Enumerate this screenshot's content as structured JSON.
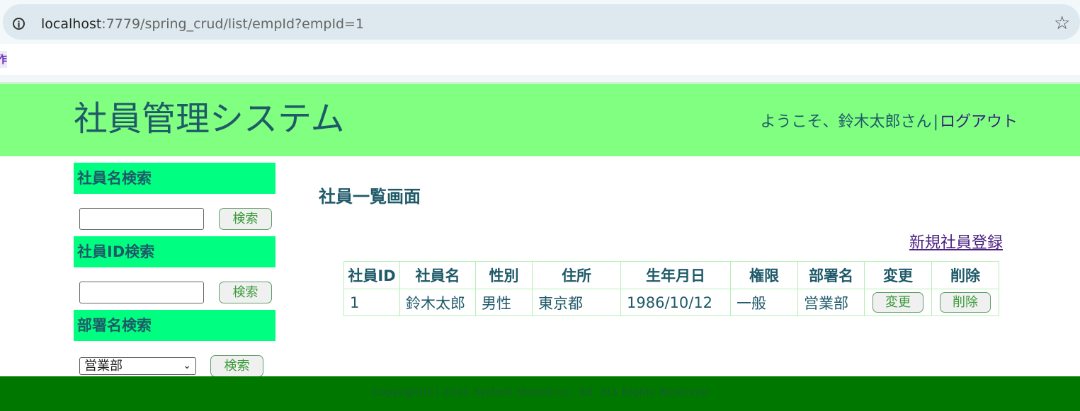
{
  "browser": {
    "url_host": "localhost",
    "url_rest": ":7779/spring_crud/list/empId?empId=1",
    "bookmark_label": "作"
  },
  "header": {
    "title": "社員管理システム",
    "greeting": "ようこそ、鈴木太郎さん",
    "separator": "|",
    "logout_label": "ログアウト"
  },
  "sidebar": {
    "name_search": {
      "heading": "社員名検索",
      "button_label": "検索",
      "value": ""
    },
    "id_search": {
      "heading": "社員ID検索",
      "button_label": "検索",
      "value": ""
    },
    "dept_search": {
      "heading": "部署名検索",
      "button_label": "検索",
      "selected": "営業部"
    }
  },
  "main": {
    "title": "社員一覧画面",
    "new_link": "新規社員登録",
    "table": {
      "headers": [
        "社員ID",
        "社員名",
        "性別",
        "住所",
        "生年月日",
        "権限",
        "部署名",
        "変更",
        "削除"
      ],
      "rows": [
        {
          "id": "1",
          "name": "鈴木太郎",
          "gender": "男性",
          "address": "東京都",
          "birthday": "1986/10/12",
          "role": "一般",
          "dept": "営業部",
          "edit_label": "変更",
          "delete_label": "削除"
        }
      ]
    }
  },
  "footer": {
    "copyright": "Copyright(C) 2021 System Shared co., ltd. ALL Rights Reserved"
  },
  "colors": {
    "header_bg": "#80ff80",
    "side_heading_bg": "#00ff80",
    "footer_bg": "#007800",
    "text": "#1f5a69"
  }
}
